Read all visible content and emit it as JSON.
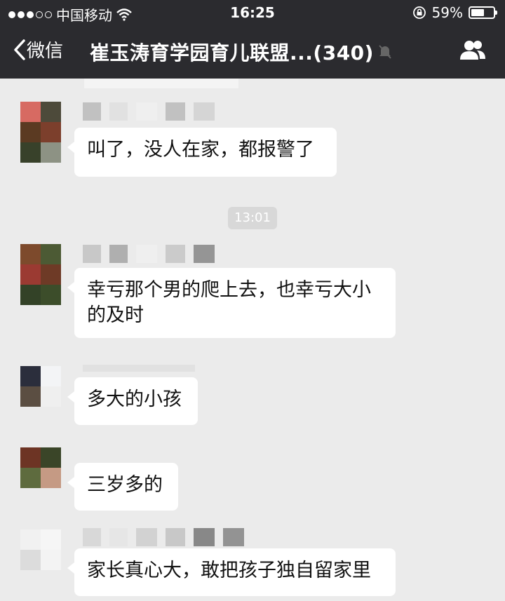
{
  "status_bar": {
    "carrier": "中国移动",
    "time": "16:25",
    "battery": "59%",
    "battery_level": 0.59
  },
  "navbar": {
    "back_label": "微信",
    "title": "崔玉涛育学园育儿联盟...(340)"
  },
  "time_separator": "13:01",
  "messages": [
    {
      "text": "叫了，没人在家，都报警了",
      "lines": [
        "叫了，没人在家，都报警了"
      ]
    },
    {
      "text": "幸亏那个男的爬上去，也幸亏大小的及时",
      "lines": [
        "幸亏那个男的爬上去，也幸亏大小",
        "的及时"
      ]
    },
    {
      "text": "多大的小孩",
      "lines": [
        "多大的小孩"
      ]
    },
    {
      "text": "三岁多的",
      "lines": [
        "三岁多的"
      ]
    },
    {
      "text": "家长真心大，敢把孩子独自留家里",
      "lines": [
        "家长真心大，敢把孩子独自留家里"
      ]
    }
  ],
  "colors": {
    "nav_bg": "#2b2b2f",
    "chat_bg": "#ebebeb",
    "bubble_bg": "#ffffff"
  }
}
